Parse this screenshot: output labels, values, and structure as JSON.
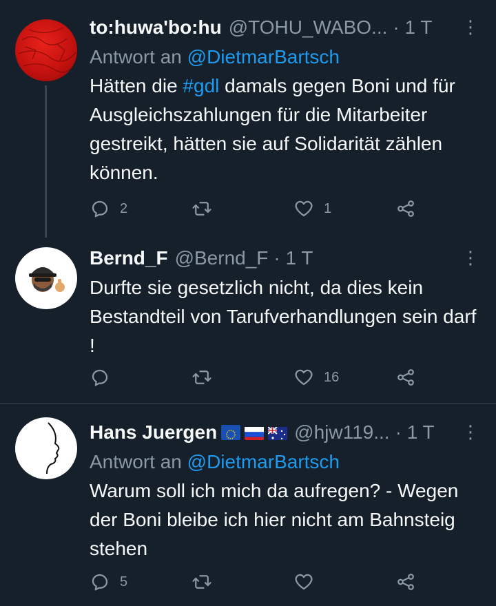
{
  "tweets": [
    {
      "name": "to:huwa'bo:hu",
      "handle": "@TOHU_WABO...",
      "time": "· 1 T",
      "reply_prefix": "Antwort an",
      "reply_to": "@DietmarBartsch",
      "text_before_tag": "Hätten die ",
      "hashtag": "#gdl",
      "text_after_tag": " damals gegen Boni und für Ausgleichszahlungen für die Mitarbeiter gestreikt, hätten sie auf Solidarität zählen können.",
      "replies": "2",
      "retweets": "",
      "likes": "1"
    },
    {
      "name": "Bernd_F",
      "handle": "@Bernd_F",
      "time": "· 1 T",
      "text": "Durfte sie gesetzlich nicht, da dies kein Bestandteil von Tarufverhandlungen sein darf !",
      "replies": "",
      "retweets": "",
      "likes": "16"
    },
    {
      "name": "Hans Juergen",
      "handle": "@hjw119...",
      "time": "· 1 T",
      "reply_prefix": "Antwort an",
      "reply_to": "@DietmarBartsch",
      "text": "Warum soll ich mich da aufregen? - Wegen der Boni bleibe ich hier nicht am Bahnsteig stehen",
      "replies": "5",
      "retweets": "",
      "likes": ""
    }
  ],
  "colors": {
    "background": "#15202b",
    "text": "#f7f9f9",
    "secondary": "#8b98a5",
    "link": "#1d9bf0",
    "divider": "#38444d"
  },
  "icons": [
    "reply-icon",
    "retweet-icon",
    "like-icon",
    "share-icon",
    "more-icon"
  ]
}
